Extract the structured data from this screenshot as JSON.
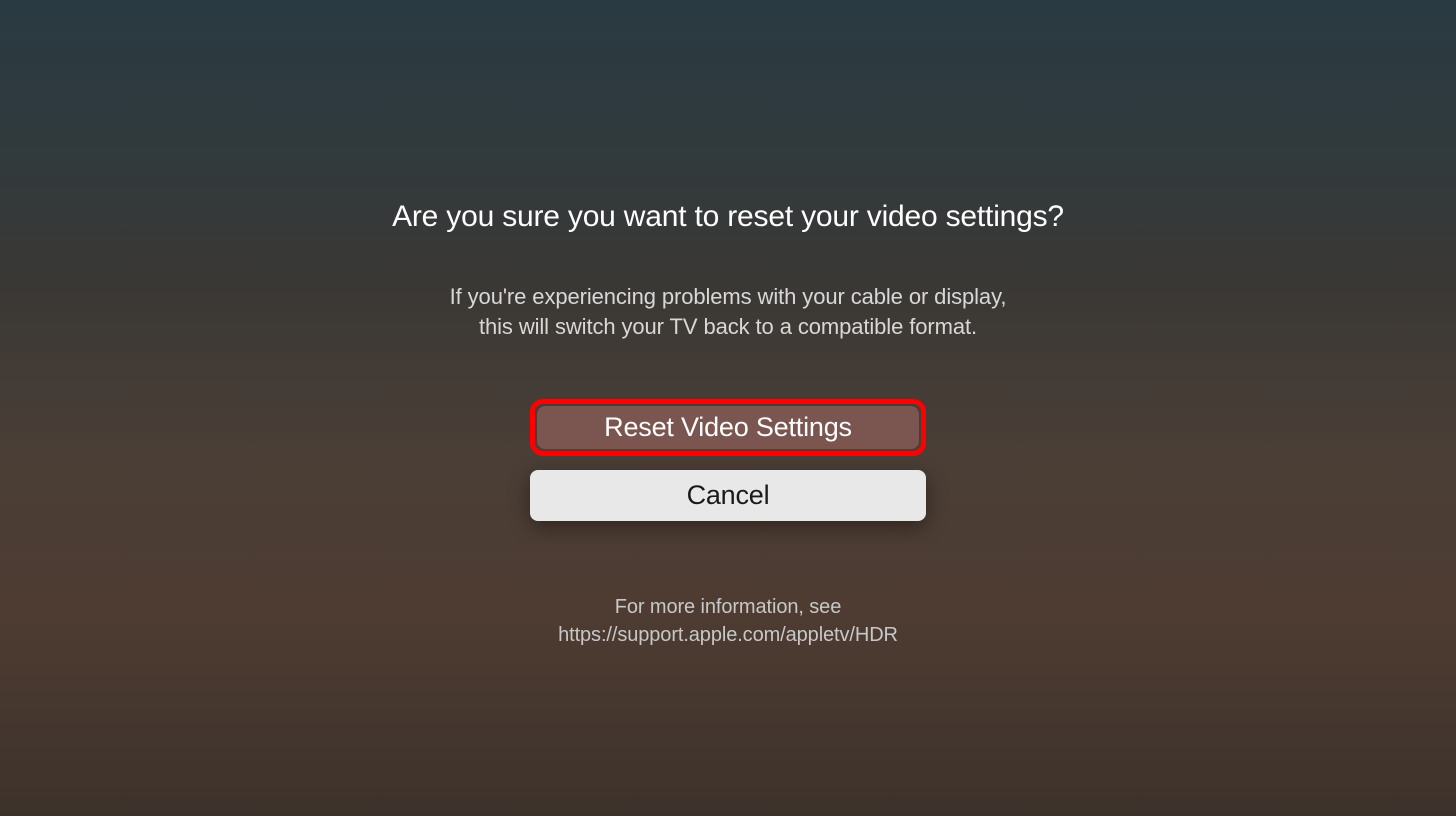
{
  "dialog": {
    "title": "Are you sure you want to reset your video settings?",
    "description_line1": "If you're experiencing problems with your cable or display,",
    "description_line2": "this will switch your TV back to a compatible format.",
    "reset_button_label": "Reset Video Settings",
    "cancel_button_label": "Cancel",
    "footer_line1": "For more information, see",
    "footer_line2": "https://support.apple.com/appletv/HDR"
  }
}
